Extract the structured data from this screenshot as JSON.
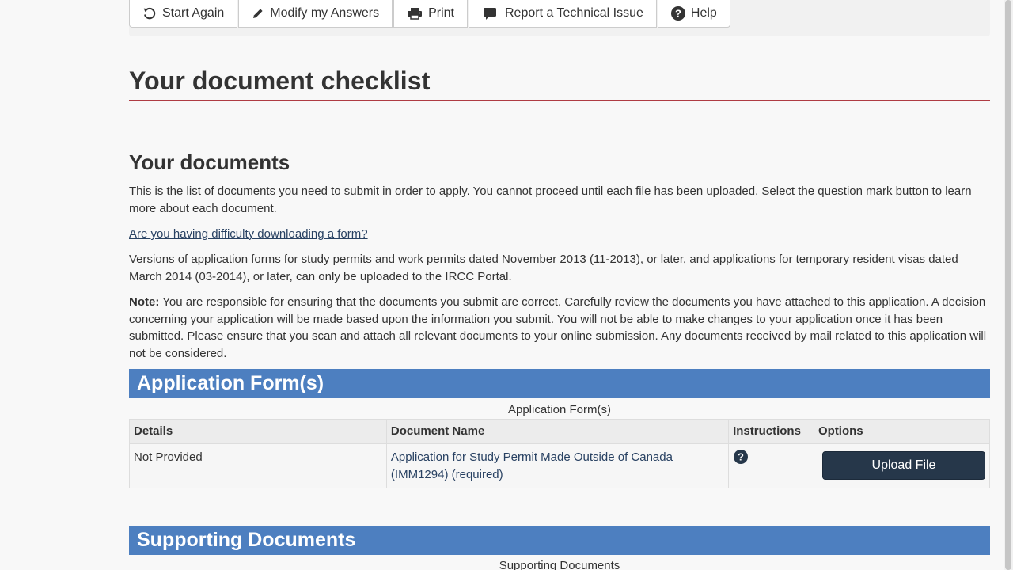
{
  "toolbar": {
    "items": [
      {
        "label": "Start Again",
        "icon": "refresh-icon"
      },
      {
        "label": "Modify my Answers",
        "icon": "pencil-icon"
      },
      {
        "label": "Print",
        "icon": "printer-icon"
      },
      {
        "label": "Report a Technical Issue",
        "icon": "comment-icon"
      },
      {
        "label": "Help",
        "icon": "question-circle-icon"
      }
    ]
  },
  "page": {
    "title": "Your document checklist"
  },
  "documents": {
    "heading": "Your documents",
    "intro": "This is the list of documents you need to submit in order to apply. You cannot proceed until each file has been uploaded. Select the question mark button to learn more about each document.",
    "difficulty_link": "Are you having difficulty downloading a form?",
    "versions_note": "Versions of application forms for study permits and work permits dated November 2013 (11-2013), or later, and applications for temporary resident visas dated March 2014 (03-2014), or later, can only be uploaded to the IRCC Portal.",
    "note_label": "Note:",
    "note_text": " You are responsible for ensuring that the documents you submit are correct. Carefully review the documents you have attached to this application. A decision concerning your application will be made based upon the information you submit. You will not be able to make changes to your application once it has been submitted. Please ensure that you scan and attach all relevant documents to your online submission.  Any documents received by mail related to this application will not be considered."
  },
  "application_forms": {
    "heading": "Application Form(s)",
    "caption": "Application Form(s)",
    "columns": [
      "Details",
      "Document Name",
      "Instructions",
      "Options"
    ],
    "rows": [
      {
        "details": "Not Provided",
        "document_name": "Application for Study Permit Made Outside of Canada (IMM1294)  (required)",
        "instructions_icon": "question-circle-icon",
        "option_label": "Upload File"
      }
    ]
  },
  "supporting_documents": {
    "heading": "Supporting Documents",
    "caption": "Supporting Documents"
  },
  "colors": {
    "band": "#4d7fc0",
    "upload_button": "#26374a",
    "title_rule": "#af3c43",
    "link": "#284162"
  }
}
